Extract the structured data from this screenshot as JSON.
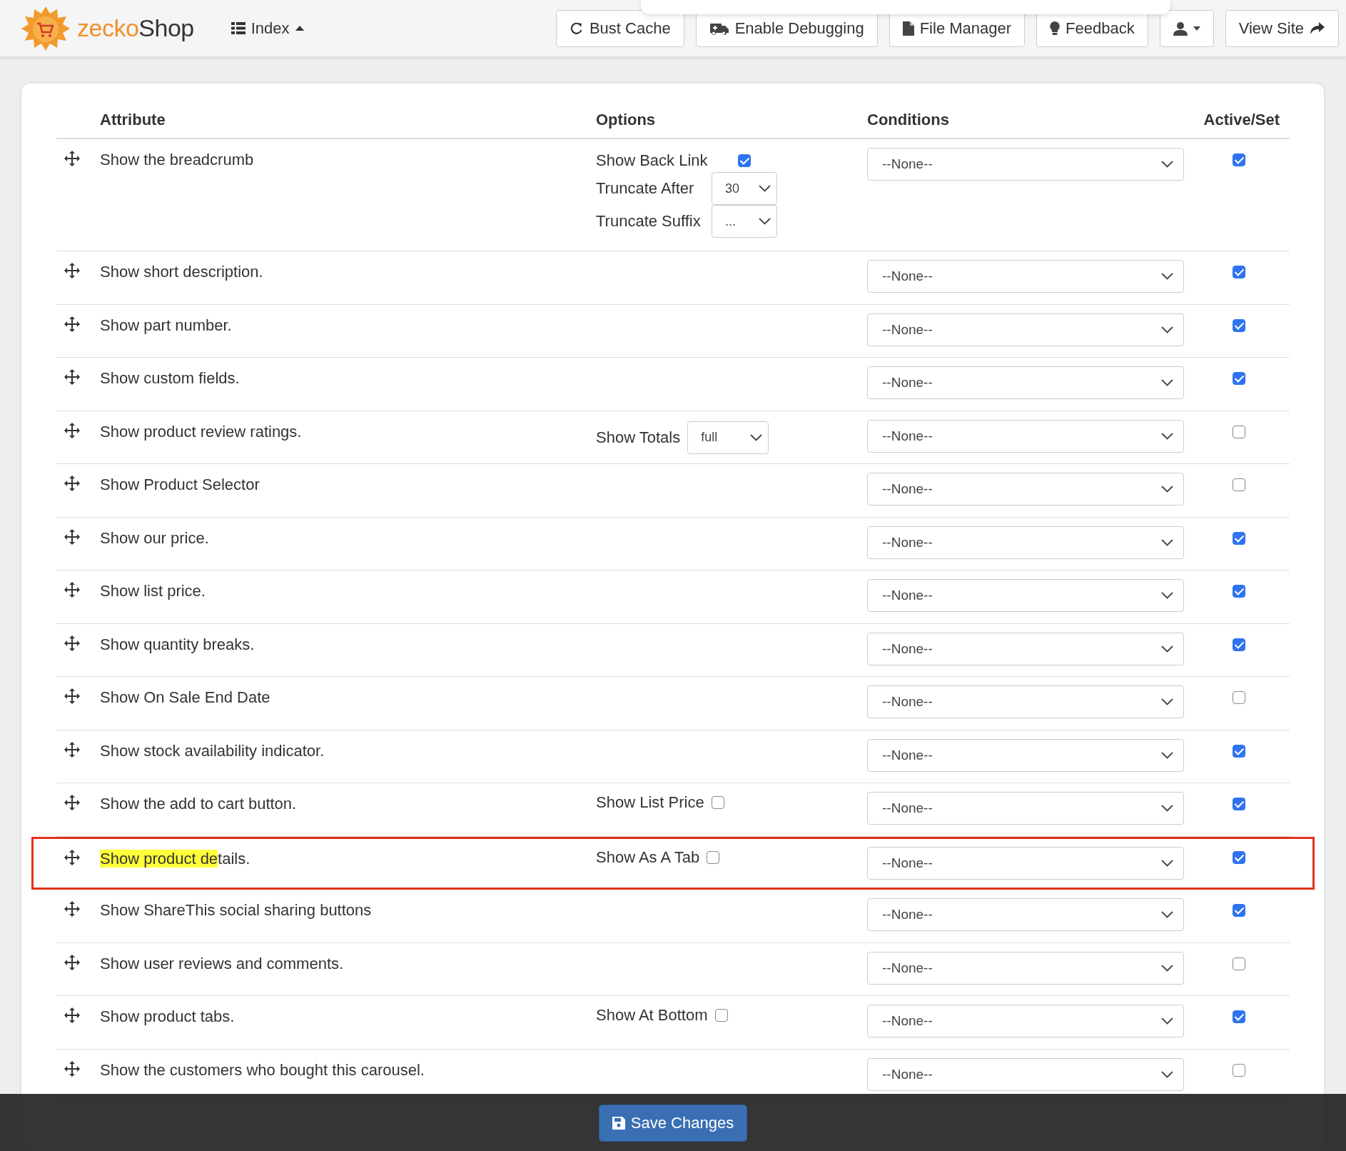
{
  "topbar": {
    "logo": {
      "prefix": "zecko",
      "suffix": "Shop"
    },
    "menu": {
      "label": "Index",
      "expanded": true
    },
    "buttons": [
      {
        "kind": "refresh",
        "label": "Bust Cache"
      },
      {
        "kind": "ambulance",
        "label": "Enable Debugging"
      },
      {
        "kind": "file",
        "label": "File Manager"
      },
      {
        "kind": "bulb",
        "label": "Feedback"
      },
      {
        "kind": "user"
      },
      {
        "kind": "share",
        "label": "View Site"
      }
    ]
  },
  "table": {
    "columns": [
      "Attribute",
      "Options",
      "Conditions",
      "Active/Set"
    ],
    "rows": [
      {
        "attribute": [
          {
            "text": "Show the breadcrumb",
            "highlighted": false
          }
        ],
        "outlined": false,
        "options": [
          {
            "kind": "checkbox",
            "label": "Show Back Link",
            "checked": true
          },
          {
            "kind": "select",
            "label": "Truncate After",
            "value": "30"
          },
          {
            "kind": "select",
            "label": "Truncate Suffix",
            "value": "..."
          }
        ],
        "condition": "--None--",
        "active": true
      },
      {
        "attribute": [
          {
            "text": "Show short description.",
            "highlighted": false
          }
        ],
        "outlined": false,
        "options": [],
        "condition": "--None--",
        "active": true
      },
      {
        "attribute": [
          {
            "text": "Show part number.",
            "highlighted": false
          }
        ],
        "outlined": false,
        "options": [],
        "condition": "--None--",
        "active": true
      },
      {
        "attribute": [
          {
            "text": "Show custom fields.",
            "highlighted": false
          }
        ],
        "outlined": false,
        "options": [],
        "condition": "--None--",
        "active": true
      },
      {
        "attribute": [
          {
            "text": "Show product review ratings.",
            "highlighted": false
          }
        ],
        "outlined": false,
        "options": [
          {
            "kind": "select",
            "label": "Show Totals",
            "value": "full"
          }
        ],
        "condition": "--None--",
        "active": false
      },
      {
        "attribute": [
          {
            "text": "Show Product Selector",
            "highlighted": false
          }
        ],
        "outlined": false,
        "options": [],
        "condition": "--None--",
        "active": false
      },
      {
        "attribute": [
          {
            "text": "Show our price.",
            "highlighted": false
          }
        ],
        "outlined": false,
        "options": [],
        "condition": "--None--",
        "active": true
      },
      {
        "attribute": [
          {
            "text": "Show list price.",
            "highlighted": false
          }
        ],
        "outlined": false,
        "options": [],
        "condition": "--None--",
        "active": true
      },
      {
        "attribute": [
          {
            "text": "Show quantity breaks.",
            "highlighted": false
          }
        ],
        "outlined": false,
        "options": [],
        "condition": "--None--",
        "active": true
      },
      {
        "attribute": [
          {
            "text": "Show On Sale End Date",
            "highlighted": false
          }
        ],
        "outlined": false,
        "options": [],
        "condition": "--None--",
        "active": false
      },
      {
        "attribute": [
          {
            "text": "Show stock availability indicator.",
            "highlighted": false
          }
        ],
        "outlined": false,
        "options": [],
        "condition": "--None--",
        "active": true
      },
      {
        "attribute": [
          {
            "text": "Show the add to cart button.",
            "highlighted": false
          }
        ],
        "outlined": false,
        "options": [
          {
            "kind": "checkbox",
            "label": "Show List Price",
            "checked": false
          }
        ],
        "condition": "--None--",
        "active": true
      },
      {
        "attribute": [
          {
            "text": "Show product de",
            "highlighted": true
          },
          {
            "text": "tails.",
            "highlighted": false
          }
        ],
        "outlined": true,
        "options": [
          {
            "kind": "checkbox",
            "label": "Show As A Tab",
            "checked": false
          }
        ],
        "condition": "--None--",
        "active": true
      },
      {
        "attribute": [
          {
            "text": "Show ShareThis social sharing buttons",
            "highlighted": false
          }
        ],
        "outlined": false,
        "options": [],
        "condition": "--None--",
        "active": true
      },
      {
        "attribute": [
          {
            "text": "Show user reviews and comments.",
            "highlighted": false
          }
        ],
        "outlined": false,
        "options": [],
        "condition": "--None--",
        "active": false
      },
      {
        "attribute": [
          {
            "text": "Show product tabs.",
            "highlighted": false
          }
        ],
        "outlined": false,
        "options": [
          {
            "kind": "checkbox",
            "label": "Show At Bottom",
            "checked": false
          }
        ],
        "condition": "--None--",
        "active": true
      },
      {
        "attribute": [
          {
            "text": "Show the customers who bought this carousel.",
            "highlighted": false
          }
        ],
        "outlined": false,
        "options": [],
        "condition": "--None--",
        "active": false
      }
    ]
  },
  "save_button": {
    "label": "Save Changes"
  }
}
